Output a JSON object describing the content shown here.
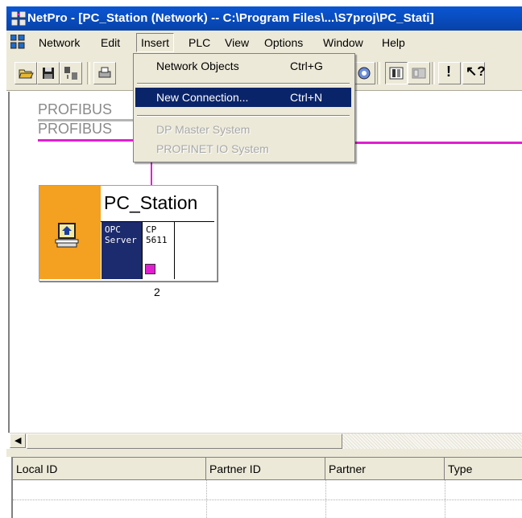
{
  "window": {
    "title": "NetPro - [PC_Station (Network) -- C:\\Program Files\\...\\S7proj\\PC_Stati]"
  },
  "menubar": {
    "items": [
      "Network",
      "Edit",
      "Insert",
      "PLC",
      "View",
      "Options",
      "Window",
      "Help"
    ],
    "open_menu": "Insert"
  },
  "insert_menu": {
    "items": [
      {
        "label": "Network Objects",
        "shortcut": "Ctrl+G",
        "state": "normal"
      },
      {
        "label": "New Connection...",
        "shortcut": "Ctrl+N",
        "state": "highlighted"
      },
      {
        "label": "DP Master System",
        "shortcut": "",
        "state": "disabled"
      },
      {
        "label": "PROFINET IO System",
        "shortcut": "",
        "state": "disabled"
      }
    ]
  },
  "toolbar": {
    "icons": [
      "open-icon",
      "save-icon",
      "accessible-nodes-icon",
      "print-icon",
      "network-icon",
      "station-icon",
      "properties-icon",
      "exclamation-icon",
      "help-icon"
    ],
    "exclamation_label": "!",
    "help_label": "?"
  },
  "canvas": {
    "subnets": [
      "PROFIBUS",
      "PROFIBUS"
    ],
    "station": {
      "name": "PC_Station",
      "module1": "OPC\nServer",
      "module2": "CP\n5611",
      "number": "2"
    },
    "colors": {
      "station_bg": "#f4a020",
      "opc_module": "#1c2a6e",
      "profibus_line": "#e020d0"
    }
  },
  "connections_table": {
    "columns": [
      "Local ID",
      "Partner ID",
      "Partner",
      "Type"
    ],
    "rows": []
  }
}
